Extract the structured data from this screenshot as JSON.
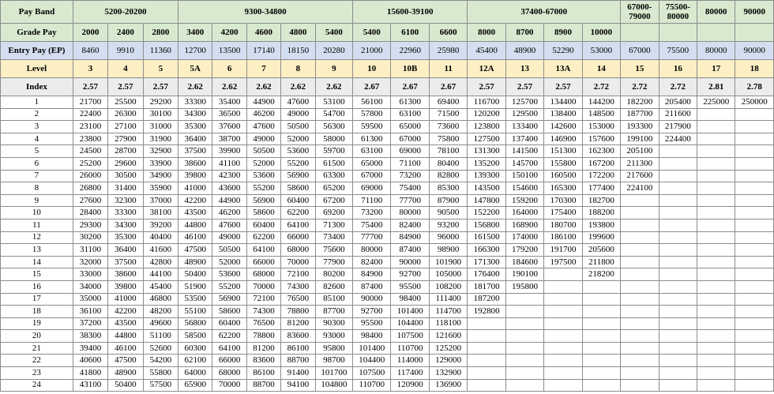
{
  "pay_band": {
    "label": "Pay Band",
    "groups": [
      {
        "label": "5200-20200",
        "span": 3
      },
      {
        "label": "9300-34800",
        "span": 5
      },
      {
        "label": "15600-39100",
        "span": 3
      },
      {
        "label": "37400-67000",
        "span": 4
      },
      {
        "label": "67000-79000",
        "span": 1
      },
      {
        "label": "75500-80000",
        "span": 1
      },
      {
        "label": "80000",
        "span": 1
      },
      {
        "label": "90000",
        "span": 1
      }
    ]
  },
  "grade_pay": {
    "label": "Grade Pay",
    "values": [
      "2000",
      "2400",
      "2800",
      "3400",
      "4200",
      "4600",
      "4800",
      "5400",
      "5400",
      "6100",
      "6600",
      "8000",
      "8700",
      "8900",
      "10000",
      "",
      "",
      "",
      ""
    ]
  },
  "entry_pay": {
    "label": "Entry Pay (EP)",
    "values": [
      "8460",
      "9910",
      "11360",
      "12700",
      "13500",
      "17140",
      "18150",
      "20280",
      "21000",
      "22960",
      "25980",
      "45400",
      "48900",
      "52290",
      "53000",
      "67000",
      "75500",
      "80000",
      "90000"
    ]
  },
  "level": {
    "label": "Level",
    "values": [
      "3",
      "4",
      "5",
      "5A",
      "6",
      "7",
      "8",
      "9",
      "10",
      "10B",
      "11",
      "12A",
      "13",
      "13A",
      "14",
      "15",
      "16",
      "17",
      "18"
    ]
  },
  "index": {
    "label": "Index",
    "values": [
      "2.57",
      "2.57",
      "2.57",
      "2.62",
      "2.62",
      "2.62",
      "2.62",
      "2.62",
      "2.67",
      "2.67",
      "2.67",
      "2.57",
      "2.57",
      "2.57",
      "2.72",
      "2.72",
      "2.72",
      "2.81",
      "2.78"
    ]
  },
  "rows": [
    [
      "1",
      "21700",
      "25500",
      "29200",
      "33300",
      "35400",
      "44900",
      "47600",
      "53100",
      "56100",
      "61300",
      "69400",
      "116700",
      "125700",
      "134400",
      "144200",
      "182200",
      "205400",
      "225000",
      "250000"
    ],
    [
      "2",
      "22400",
      "26300",
      "30100",
      "34300",
      "36500",
      "46200",
      "49000",
      "54700",
      "57800",
      "63100",
      "71500",
      "120200",
      "129500",
      "138400",
      "148500",
      "187700",
      "211600",
      "",
      ""
    ],
    [
      "3",
      "23100",
      "27100",
      "31000",
      "35300",
      "37600",
      "47600",
      "50500",
      "56300",
      "59500",
      "65000",
      "73600",
      "123800",
      "133400",
      "142600",
      "153000",
      "193300",
      "217900",
      "",
      ""
    ],
    [
      "4",
      "23800",
      "27900",
      "31900",
      "36400",
      "38700",
      "49000",
      "52000",
      "58000",
      "61300",
      "67000",
      "75800",
      "127500",
      "137400",
      "146900",
      "157600",
      "199100",
      "224400",
      "",
      ""
    ],
    [
      "5",
      "24500",
      "28700",
      "32900",
      "37500",
      "39900",
      "50500",
      "53600",
      "59700",
      "63100",
      "69000",
      "78100",
      "131300",
      "141500",
      "151300",
      "162300",
      "205100",
      "",
      "",
      ""
    ],
    [
      "6",
      "25200",
      "29600",
      "33900",
      "38600",
      "41100",
      "52000",
      "55200",
      "61500",
      "65000",
      "71100",
      "80400",
      "135200",
      "145700",
      "155800",
      "167200",
      "211300",
      "",
      "",
      ""
    ],
    [
      "7",
      "26000",
      "30500",
      "34900",
      "39800",
      "42300",
      "53600",
      "56900",
      "63300",
      "67000",
      "73200",
      "82800",
      "139300",
      "150100",
      "160500",
      "172200",
      "217600",
      "",
      "",
      ""
    ],
    [
      "8",
      "26800",
      "31400",
      "35900",
      "41000",
      "43600",
      "55200",
      "58600",
      "65200",
      "69000",
      "75400",
      "85300",
      "143500",
      "154600",
      "165300",
      "177400",
      "224100",
      "",
      "",
      ""
    ],
    [
      "9",
      "27600",
      "32300",
      "37000",
      "42200",
      "44900",
      "56900",
      "60400",
      "67200",
      "71100",
      "77700",
      "87900",
      "147800",
      "159200",
      "170300",
      "182700",
      "",
      "",
      "",
      ""
    ],
    [
      "10",
      "28400",
      "33300",
      "38100",
      "43500",
      "46200",
      "58600",
      "62200",
      "69200",
      "73200",
      "80000",
      "90500",
      "152200",
      "164000",
      "175400",
      "188200",
      "",
      "",
      "",
      ""
    ],
    [
      "11",
      "29300",
      "34300",
      "39200",
      "44800",
      "47600",
      "60400",
      "64100",
      "71300",
      "75400",
      "82400",
      "93200",
      "156800",
      "168900",
      "180700",
      "193800",
      "",
      "",
      "",
      ""
    ],
    [
      "12",
      "30200",
      "35300",
      "40400",
      "46100",
      "49000",
      "62200",
      "66000",
      "73400",
      "77700",
      "84900",
      "96000",
      "161500",
      "174000",
      "186100",
      "199600",
      "",
      "",
      "",
      ""
    ],
    [
      "13",
      "31100",
      "36400",
      "41600",
      "47500",
      "50500",
      "64100",
      "68000",
      "75600",
      "80000",
      "87400",
      "98900",
      "166300",
      "179200",
      "191700",
      "205600",
      "",
      "",
      "",
      ""
    ],
    [
      "14",
      "32000",
      "37500",
      "42800",
      "48900",
      "52000",
      "66000",
      "70000",
      "77900",
      "82400",
      "90000",
      "101900",
      "171300",
      "184600",
      "197500",
      "211800",
      "",
      "",
      "",
      ""
    ],
    [
      "15",
      "33000",
      "38600",
      "44100",
      "50400",
      "53600",
      "68000",
      "72100",
      "80200",
      "84900",
      "92700",
      "105000",
      "176400",
      "190100",
      "",
      "218200",
      "",
      "",
      "",
      ""
    ],
    [
      "16",
      "34000",
      "39800",
      "45400",
      "51900",
      "55200",
      "70000",
      "74300",
      "82600",
      "87400",
      "95500",
      "108200",
      "181700",
      "195800",
      "",
      "",
      "",
      "",
      "",
      ""
    ],
    [
      "17",
      "35000",
      "41000",
      "46800",
      "53500",
      "56900",
      "72100",
      "76500",
      "85100",
      "90000",
      "98400",
      "111400",
      "187200",
      "",
      "",
      "",
      "",
      "",
      "",
      ""
    ],
    [
      "18",
      "36100",
      "42200",
      "48200",
      "55100",
      "58600",
      "74300",
      "78800",
      "87700",
      "92700",
      "101400",
      "114700",
      "192800",
      "",
      "",
      "",
      "",
      "",
      "",
      ""
    ],
    [
      "19",
      "37200",
      "43500",
      "49600",
      "56800",
      "60400",
      "76500",
      "81200",
      "90300",
      "95500",
      "104400",
      "118100",
      "",
      "",
      "",
      "",
      "",
      "",
      "",
      ""
    ],
    [
      "20",
      "38300",
      "44800",
      "51100",
      "58500",
      "62200",
      "78800",
      "83600",
      "93000",
      "98400",
      "107500",
      "121600",
      "",
      "",
      "",
      "",
      "",
      "",
      "",
      ""
    ],
    [
      "21",
      "39400",
      "46100",
      "52600",
      "60300",
      "64100",
      "81200",
      "86100",
      "95800",
      "101400",
      "110700",
      "125200",
      "",
      "",
      "",
      "",
      "",
      "",
      "",
      ""
    ],
    [
      "22",
      "40600",
      "47500",
      "54200",
      "62100",
      "66000",
      "83600",
      "88700",
      "98700",
      "104400",
      "114000",
      "129000",
      "",
      "",
      "",
      "",
      "",
      "",
      "",
      ""
    ],
    [
      "23",
      "41800",
      "48900",
      "55800",
      "64000",
      "68000",
      "86100",
      "91400",
      "101700",
      "107500",
      "117400",
      "132900",
      "",
      "",
      "",
      "",
      "",
      "",
      "",
      ""
    ],
    [
      "24",
      "43100",
      "50400",
      "57500",
      "65900",
      "70000",
      "88700",
      "94100",
      "104800",
      "110700",
      "120900",
      "136900",
      "",
      "",
      "",
      "",
      "",
      "",
      "",
      ""
    ]
  ]
}
